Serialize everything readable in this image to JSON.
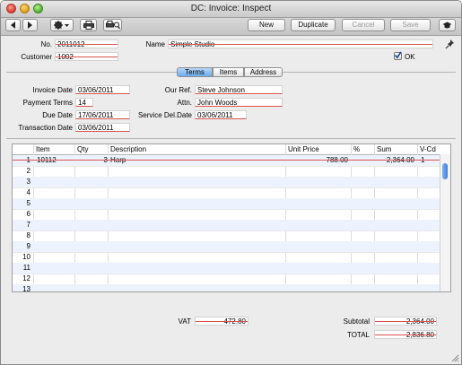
{
  "window": {
    "title": "DC: Invoice: Inspect"
  },
  "toolbar": {
    "new_label": "New",
    "duplicate_label": "Duplicate",
    "cancel_label": "Cancel",
    "save_label": "Save"
  },
  "header": {
    "no_label": "No.",
    "no_value": "2011012",
    "customer_label": "Customer",
    "customer_value": "1002",
    "name_label": "Name",
    "name_value": "Simple Studio",
    "ok_label": "OK"
  },
  "tabs": [
    {
      "label": "Terms"
    },
    {
      "label": "Items"
    },
    {
      "label": "Address"
    }
  ],
  "terms": {
    "invoice_date_label": "Invoice Date",
    "invoice_date_value": "03/06/2011",
    "payment_terms_label": "Payment Terms",
    "payment_terms_value": "14",
    "due_date_label": "Due Date",
    "due_date_value": "17/06/2011",
    "transaction_date_label": "Transaction Date",
    "transaction_date_value": "03/06/2011",
    "our_ref_label": "Our Ref.",
    "our_ref_value": "Steve Johnson",
    "attn_label": "Attn.",
    "attn_value": "John Woods",
    "service_del_date_label": "Service Del.Date",
    "service_del_date_value": "03/06/2011"
  },
  "grid": {
    "columns": [
      "Item",
      "Qty",
      "Description",
      "Unit Price",
      "%",
      "Sum",
      "V-Cd"
    ],
    "rows": [
      {
        "n": "1",
        "item": "10112",
        "qty": "3",
        "desc": "Harp",
        "price": "788.00",
        "pct": "",
        "sum": "2,364.00",
        "vcd": "1"
      },
      {
        "n": "2"
      },
      {
        "n": "3"
      },
      {
        "n": "4"
      },
      {
        "n": "5"
      },
      {
        "n": "6"
      },
      {
        "n": "7"
      },
      {
        "n": "8"
      },
      {
        "n": "9"
      },
      {
        "n": "10"
      },
      {
        "n": "11"
      },
      {
        "n": "12"
      },
      {
        "n": "13"
      }
    ]
  },
  "totals": {
    "vat_label": "VAT",
    "vat_value": "472.80",
    "subtotal_label": "Subtotal",
    "subtotal_value": "2,364.00",
    "total_label": "TOTAL",
    "total_value": "2,836.80"
  }
}
